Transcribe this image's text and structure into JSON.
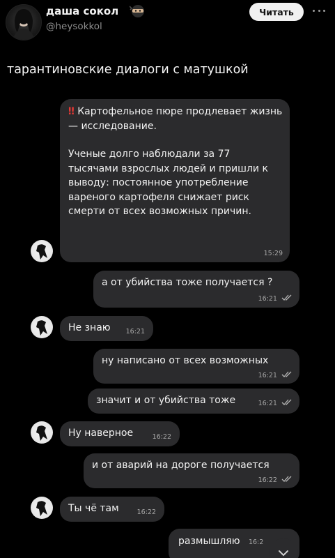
{
  "post": {
    "author": {
      "display_name": "даша сокол",
      "name_emoji": "ninja-emoji",
      "handle": "@heysokkol"
    },
    "follow_label": "Читать",
    "text": "тарантиновские диалоги с матушкой"
  },
  "chat": {
    "messages": [
      {
        "side": "in",
        "text_top": "Картофельное пюре продлевает жизнь — исследование.",
        "text_body": "Ученые долго наблюдали за 77 тысячами взрослых людей и пришли к выводу: постоянное употребление вареного картофеля снижает риск смерти от всех возможных причин.",
        "time": "15:29",
        "marker": "‼️"
      },
      {
        "side": "out",
        "text": "а от убийства тоже получается ?",
        "time": "16:21"
      },
      {
        "side": "in",
        "text": "Не знаю",
        "time": "16:21"
      },
      {
        "side": "out",
        "text": "ну написано от всех возможных",
        "time": "16:21"
      },
      {
        "side": "out",
        "text": "значит и от убийства тоже",
        "time": "16:21"
      },
      {
        "side": "in",
        "text": "Ну наверное",
        "time": "16:22"
      },
      {
        "side": "out",
        "text": "и от аварий на дороге получается",
        "time": "16:22"
      },
      {
        "side": "in",
        "text": "Ты чё там",
        "time": "16:22"
      },
      {
        "side": "out",
        "text": "размышляю",
        "time": "16:2"
      }
    ]
  },
  "colors": {
    "background": "#000000",
    "bubble": "#2b2b2d",
    "timestamp": "#a8a8a8",
    "handle": "#8e8e8e",
    "button_bg": "#f1f1f1"
  }
}
